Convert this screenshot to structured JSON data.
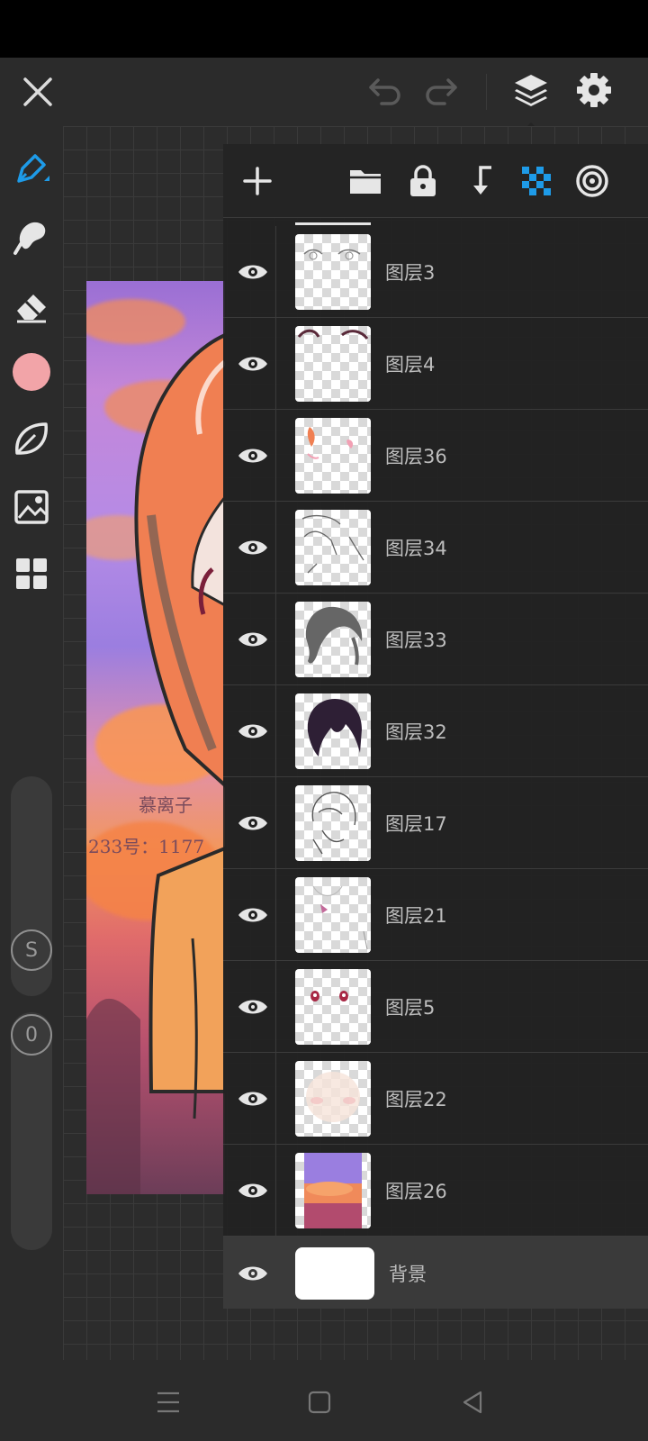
{
  "status_bar": {},
  "top_bar": {
    "icons": [
      "close-icon",
      "undo-icon",
      "redo-icon",
      "layers-icon",
      "settings-icon"
    ]
  },
  "tools": [
    "pen-icon",
    "smudge-icon",
    "eraser-icon",
    "color-swatch",
    "leaf-icon",
    "image-icon",
    "grid-icon"
  ],
  "colors": {
    "accent": "#1e9be8",
    "current_color": "#f2a4a8",
    "panel_bg": "#212121",
    "text": "#bdbdbd"
  },
  "sliders": {
    "size_label": "S",
    "opacity_label": "0"
  },
  "canvas": {
    "signature_line1": "慕离子",
    "signature_line2": "233号：1177"
  },
  "layers_panel": {
    "header_icons": [
      "add-icon",
      "folder-icon",
      "lock-icon",
      "merge-down-icon",
      "transparency-icon",
      "reference-icon"
    ],
    "layers": [
      {
        "name": "图层3"
      },
      {
        "name": "图层4"
      },
      {
        "name": "图层36"
      },
      {
        "name": "图层34"
      },
      {
        "name": "图层33"
      },
      {
        "name": "图层32"
      },
      {
        "name": "图层17"
      },
      {
        "name": "图层21"
      },
      {
        "name": "图层5"
      },
      {
        "name": "图层22"
      },
      {
        "name": "图层26"
      }
    ],
    "background_layer": {
      "name": "背景"
    }
  },
  "nav_bar": {
    "icons": [
      "menu-icon",
      "home-icon",
      "back-icon"
    ]
  }
}
